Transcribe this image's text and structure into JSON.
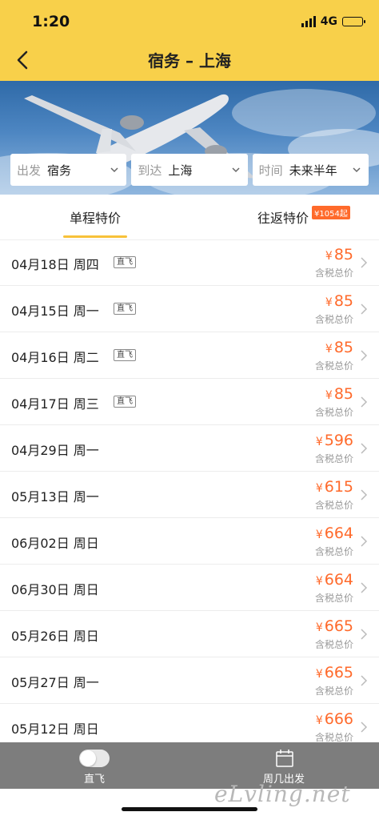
{
  "status": {
    "time": "1:20",
    "network": "4G"
  },
  "nav": {
    "title": "宿务 – 上海",
    "back_icon": "chevron-left-icon"
  },
  "selectors": [
    {
      "label": "出发",
      "value": "宿务"
    },
    {
      "label": "到达",
      "value": "上海"
    },
    {
      "label": "时间",
      "value": "未来半年"
    }
  ],
  "tabs": {
    "oneway": "单程特价",
    "roundtrip": "往返特价",
    "roundtrip_badge": "¥1054起"
  },
  "currency": "¥",
  "tax_label": "含税总价",
  "flights": [
    {
      "date": "04月18日 周四",
      "direct": "直飞",
      "price": "85"
    },
    {
      "date": "04月15日 周一",
      "direct": "直飞",
      "price": "85"
    },
    {
      "date": "04月16日 周二",
      "direct": "直飞",
      "price": "85"
    },
    {
      "date": "04月17日 周三",
      "direct": "直飞",
      "price": "85"
    },
    {
      "date": "04月29日 周一",
      "direct": "",
      "price": "596"
    },
    {
      "date": "05月13日 周一",
      "direct": "",
      "price": "615"
    },
    {
      "date": "06月02日 周日",
      "direct": "",
      "price": "664"
    },
    {
      "date": "06月30日 周日",
      "direct": "",
      "price": "664"
    },
    {
      "date": "05月26日 周日",
      "direct": "",
      "price": "665"
    },
    {
      "date": "05月27日 周一",
      "direct": "",
      "price": "665"
    },
    {
      "date": "05月12日 周日",
      "direct": "",
      "price": "666"
    }
  ],
  "bottom_bar": {
    "direct_label": "直飞",
    "weekly_label": "周几出发"
  },
  "watermark": "eLvling.net",
  "colors": {
    "header": "#f8d04a",
    "price": "#ff6a2b",
    "tab_indicator": "#f8c23a",
    "bottom_bar": "#7d7d7d"
  }
}
